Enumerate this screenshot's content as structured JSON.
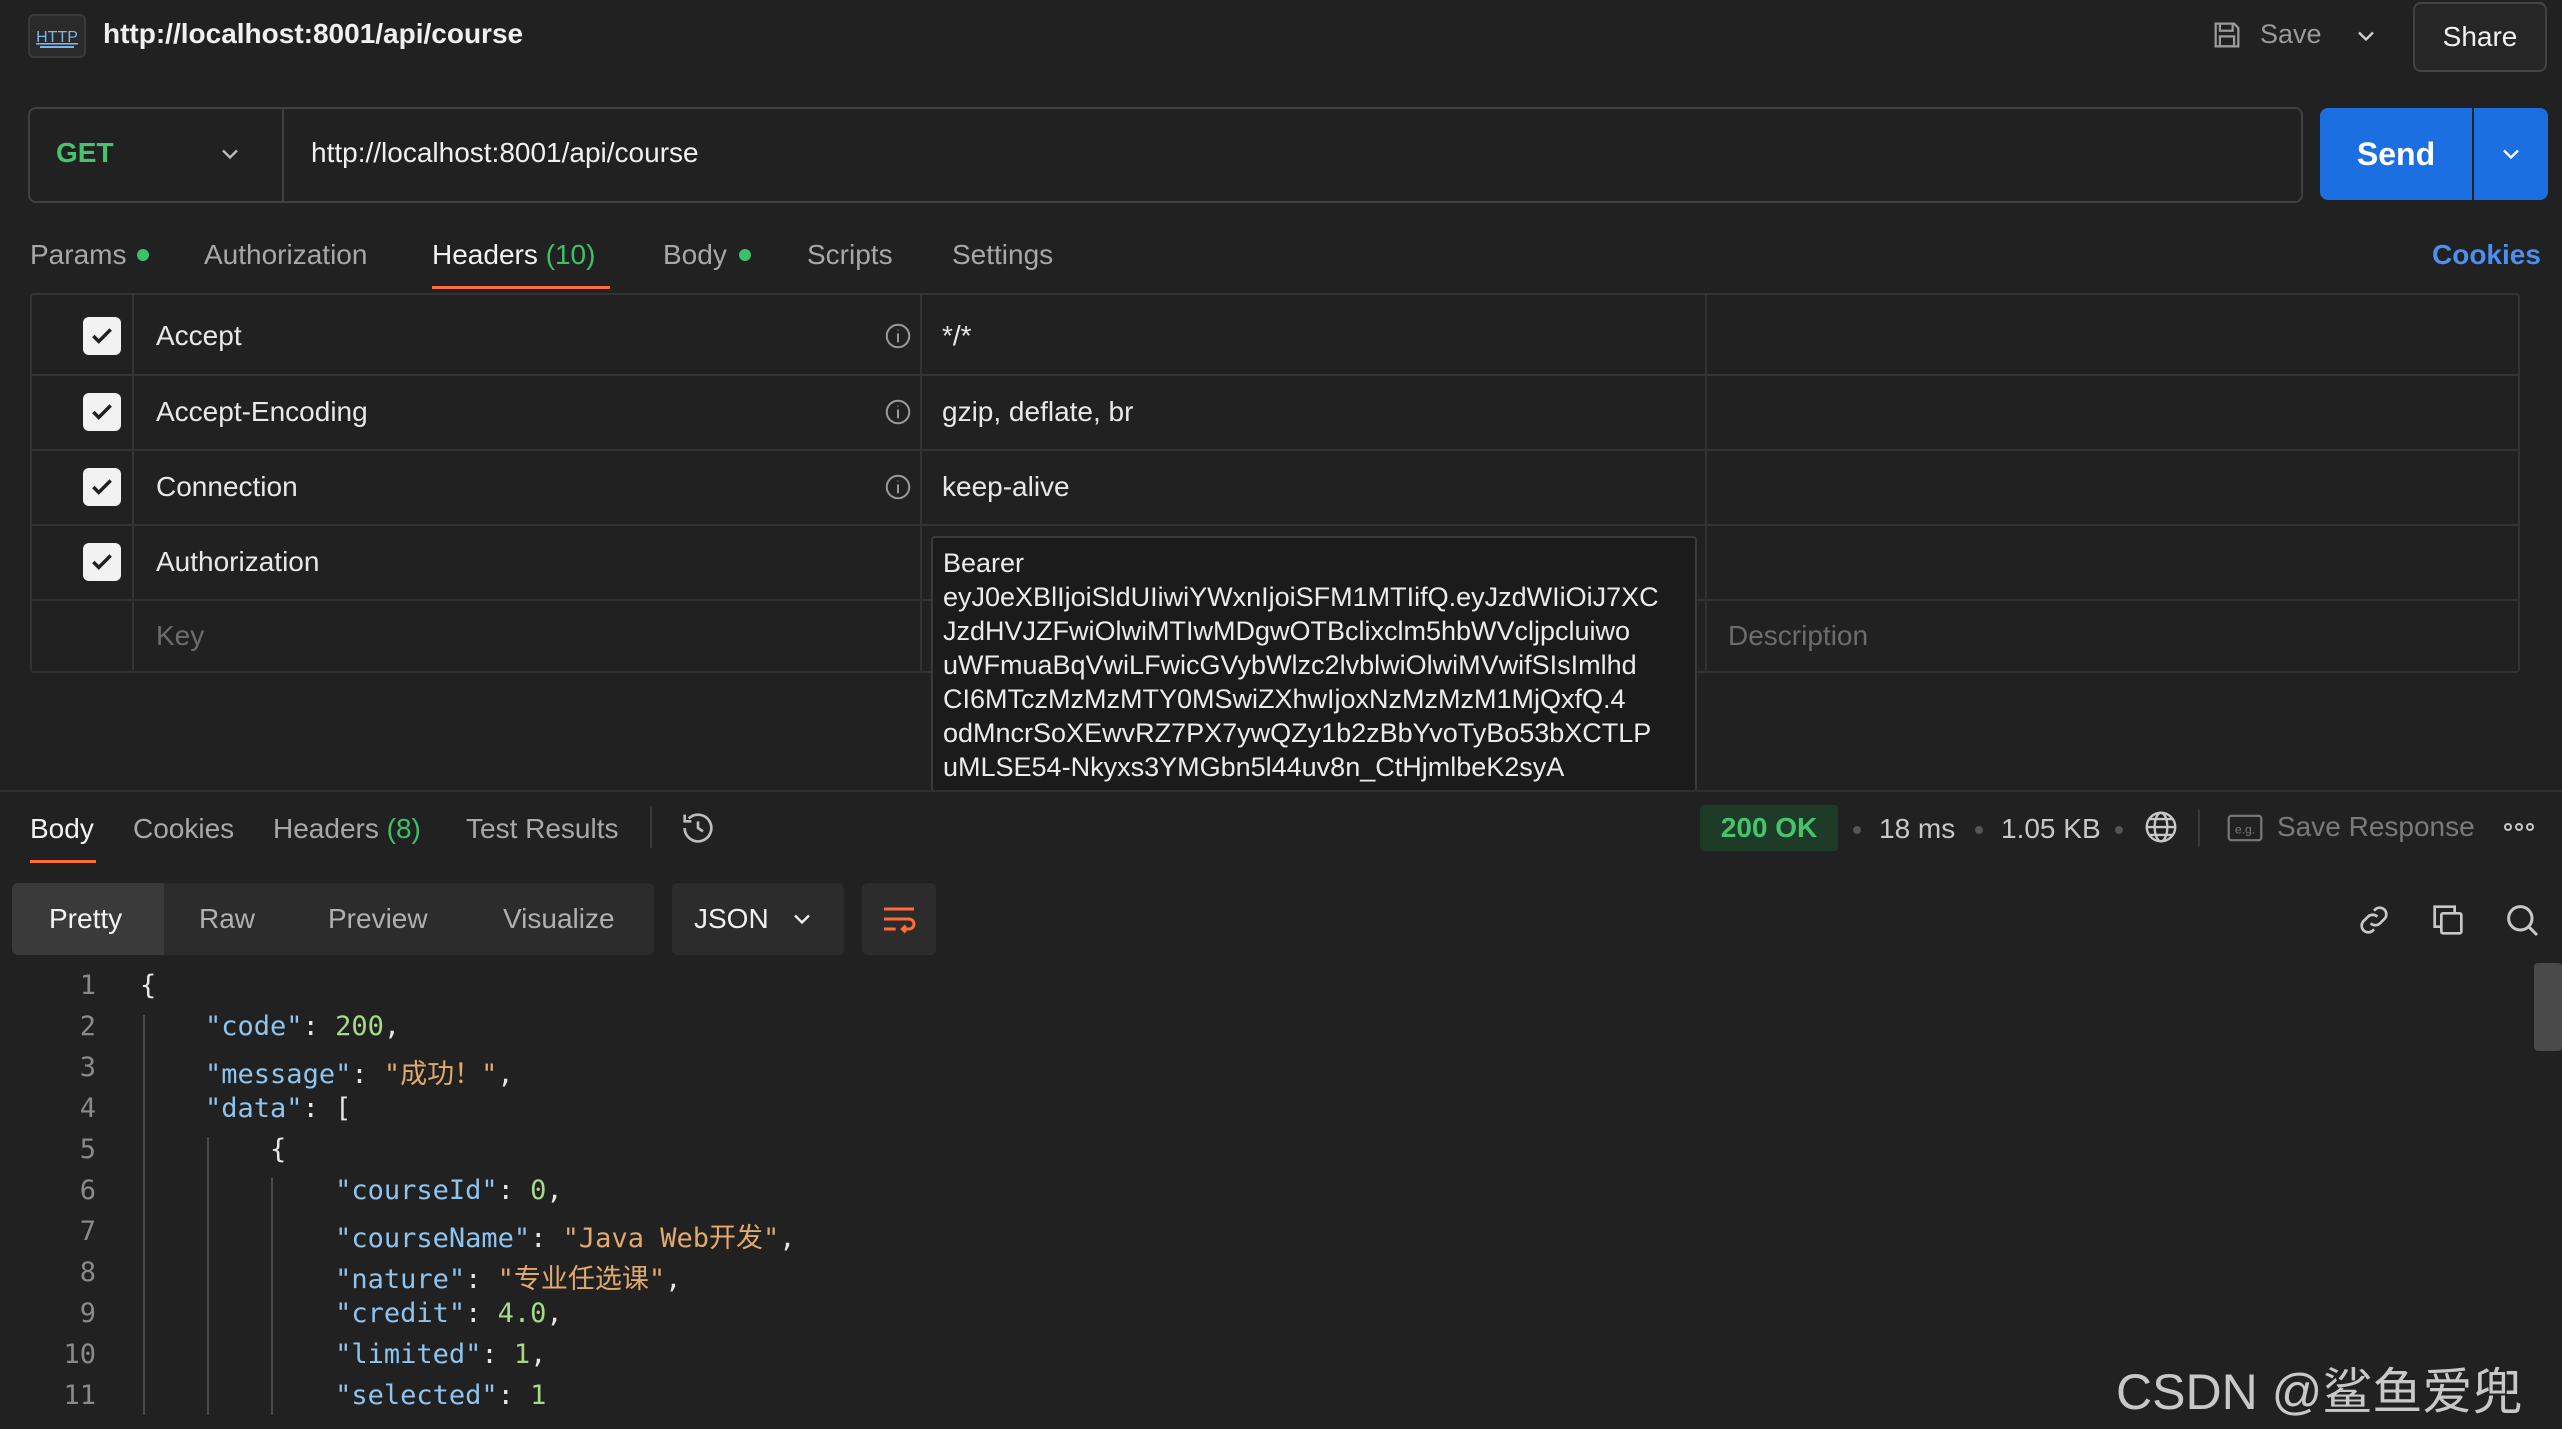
{
  "app": {
    "title": "http://localhost:8001/api/course",
    "save_label": "Save",
    "share_label": "Share"
  },
  "request": {
    "method": "GET",
    "url": "http://localhost:8001/api/course",
    "send_label": "Send",
    "tabs": [
      {
        "label": "Params",
        "dot": true
      },
      {
        "label": "Authorization"
      },
      {
        "label": "Headers",
        "count": "(10)",
        "active": true
      },
      {
        "label": "Body",
        "dot": true
      },
      {
        "label": "Scripts"
      },
      {
        "label": "Settings"
      }
    ],
    "cookies_label": "Cookies"
  },
  "headers": {
    "rows": [
      {
        "key": "Accept",
        "value": "*/*",
        "checked": true
      },
      {
        "key": "Accept-Encoding",
        "value": "gzip, deflate, br",
        "checked": true
      },
      {
        "key": "Connection",
        "value": "keep-alive",
        "checked": true
      },
      {
        "key": "Authorization",
        "checked": true
      }
    ],
    "bearer_lines": [
      "Bearer",
      "eyJ0eXBlIjoiSldUIiwiYWxnIjoiSFM1MTIifQ.eyJzdWIiOiJ7XC",
      "JzdHVJZFwiOlwiMTIwMDgwOTBclixclm5hbWVcljpcluiwo",
      "uWFmuaBqVwiLFwicGVybWlzc2lvblwiOlwiMVwifSIsImlhd",
      "CI6MTczMzMzMTY0MSwiZXhwIjoxNzMzMzM1MjQxfQ.4",
      "odMncrSoXEwvRZ7PX7ywQZy1b2zBbYvoTyBo53bXCTLP",
      "uMLSE54-Nkyxs3YMGbn5l44uv8n_CtHjmlbeK2syA"
    ],
    "key_placeholder": "Key",
    "description_placeholder": "Description"
  },
  "response": {
    "tabs": [
      {
        "label": "Body",
        "active": true
      },
      {
        "label": "Cookies"
      },
      {
        "label": "Headers",
        "count": "(8)"
      },
      {
        "label": "Test Results"
      }
    ],
    "status": "200 OK",
    "time": "18 ms",
    "size": "1.05 KB",
    "save_response_label": "Save Response",
    "formats": [
      "Pretty",
      "Raw",
      "Preview",
      "Visualize"
    ],
    "language": "JSON",
    "line_numbers": [
      "1",
      "2",
      "3",
      "4",
      "5",
      "6",
      "7",
      "8",
      "9",
      "10",
      "11"
    ]
  },
  "watermark": "CSDN @鲨鱼爱兜兜",
  "colors": {
    "accent": "#ff6c37",
    "send": "#1c6fe0",
    "success": "#44c46d"
  }
}
